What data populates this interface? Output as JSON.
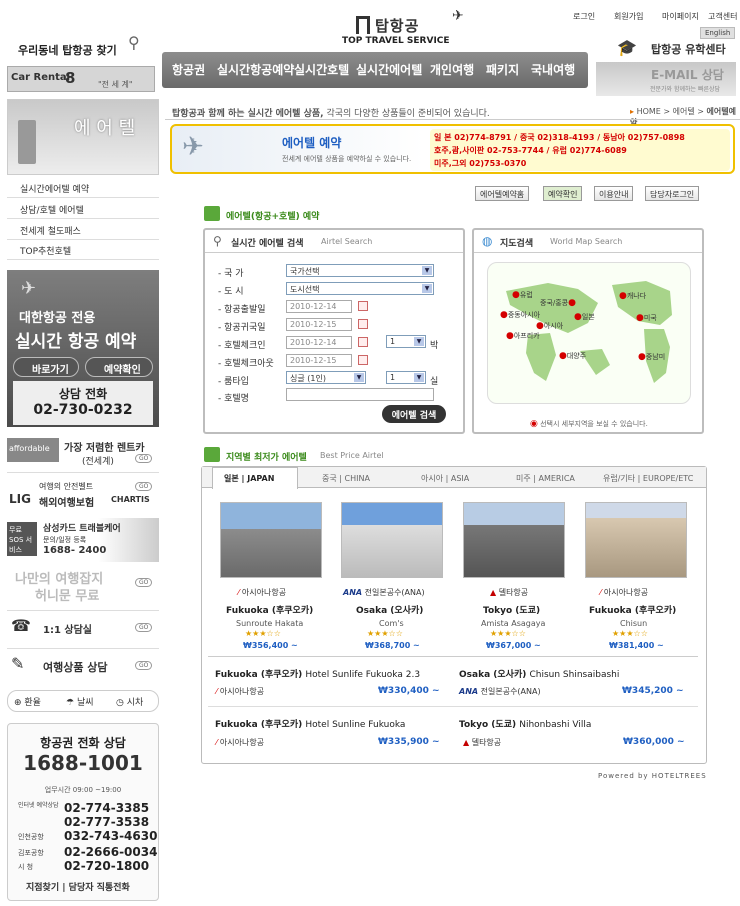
{
  "header": {
    "top_links": [
      "로그인",
      "회원가입",
      "마이페이지",
      "고객센터"
    ],
    "english": "English",
    "logo": "탑항공",
    "logo_sub": "TOP TRAVEL SERVICE",
    "local_find": "우리동네 탑항공 찾기",
    "nav": [
      "항공권",
      "실시간항공예약",
      "실시간호텔",
      "실시간에어텔",
      "개인여행",
      "패키지",
      "국내여행"
    ],
    "study_center": "탑항공 유학센타",
    "email_consult": "E-MAIL 상담",
    "email_sub": "전문가와 함께하는 빠른상담",
    "car_rental": "Car Rental",
    "car_rental_num": "8",
    "car_rental_world": "\"전 세 계\""
  },
  "sidebar": {
    "title": "에 어 텔",
    "menu": [
      "실시간에어텔 예약",
      "상담/호텔 에어텔",
      "전세계 철도패스",
      "TOP추천호텔"
    ],
    "promo": {
      "line1": "대한항공 전용",
      "line2": "실시간 항공 예약",
      "btn1": "바로가기",
      "btn2": "예약확인",
      "phone_label": "상담 전화",
      "phone": "02-730-0232"
    },
    "ads": [
      {
        "logo": "affordable",
        "title": "가장 저렴한 렌트카",
        "sub": "(전세계)"
      },
      {
        "logo": "LIG",
        "title": "여행의 안전벨트",
        "sub": "해외여행보험",
        "brand": "CHARTIS"
      },
      {
        "logo": "무료 SOS 서비스",
        "title": "삼성카드 트래블케어",
        "sub": "문의/일정 등록",
        "phone": "1688- 2400"
      },
      {
        "title": "나만의 여행잡지",
        "sub": "허니문 무료"
      }
    ],
    "consult": "1:1 상담실",
    "product_consult": "여행상품 상담",
    "go": "GO",
    "utils": [
      "환율",
      "날씨",
      "시차"
    ],
    "phone_box": {
      "title": "항공권 전화 상담",
      "number": "1688-1001",
      "hours": "업무시간  09:00 ~19:00",
      "lines": [
        {
          "label": "인터넷 예약상담",
          "value": "02-774-3385"
        },
        {
          "label": "",
          "value": "02-777-3538"
        },
        {
          "label": "인천공항",
          "value": "032-743-4630"
        },
        {
          "label": "김포공항",
          "value": "02-2666-0034"
        },
        {
          "label": "시   청",
          "value": "02-720-1800"
        }
      ],
      "footer": "지점찾기 | 담당자 직통전화"
    }
  },
  "main": {
    "intro_bold": "탑항공과 함께 하는 실시간 에어텔 상품,",
    "intro_rest": " 각국의 다양한 상품들이 준비되어 있습니다.",
    "breadcrumb": [
      "HOME",
      "에어텔",
      "에어텔예약"
    ],
    "banner_title": "에어텔 예약",
    "banner_sub": "전세계 에어텔 상품을 예약하실 수 있습니다.",
    "contacts": [
      "일   본 02)774-8791 / 중국 02)318-4193 / 동남아 02)757-0898",
      "호주,괌,사이판  02-753-7744 / 유럽 02)774-6089",
      "미주,그외 02)753-0370"
    ],
    "tabs": [
      "에어텔예약홈",
      "예약확인",
      "이용안내",
      "담당자로그인"
    ],
    "section_title": "에어텔(항공+호텔) 예약",
    "search": {
      "title": "실시간 에어텔 검색",
      "title_en": "Airtel Search",
      "fields": [
        {
          "label": "국    가",
          "value": "국가선택"
        },
        {
          "label": "도    시",
          "value": "도시선택"
        },
        {
          "label": "항공출발일",
          "value": "2010-12-14"
        },
        {
          "label": "항공귀국일",
          "value": "2010-12-15"
        },
        {
          "label": "호텔체크인",
          "value": "2010-12-14",
          "nights": "1",
          "unit": "박"
        },
        {
          "label": "호텔체크아웃",
          "value": "2010-12-15"
        },
        {
          "label": "룸타입",
          "value": "싱글 (1인)",
          "rooms": "1",
          "unit": "실"
        },
        {
          "label": "호텔명",
          "value": ""
        }
      ],
      "button": "에어텔 검색"
    },
    "map": {
      "title": "지도검색",
      "title_en": "World Map Search",
      "regions": [
        "유럽",
        "중국/홍콩",
        "캐나다",
        "중동아시아",
        "일본",
        "미국",
        "아시아",
        "아프리카",
        "대양주",
        "중남미"
      ],
      "note": "선택시 세부지역을 보실 수 있습니다."
    },
    "best": {
      "title": "지역별 최저가 에어텔",
      "title_en": "Best Price Airtel",
      "tabs": [
        "일본 | JAPAN",
        "중국 | CHINA",
        "아시아 | ASIA",
        "미주 | AMERICA",
        "유럽/기타 | EUROPE/ETC"
      ],
      "cards": [
        {
          "airline": "아시아나항공",
          "city": "Fukuoka (후쿠오카)",
          "hotel": "Sunroute Hakata",
          "stars": "★★★☆☆",
          "price": "₩356,400 ~"
        },
        {
          "airline": "전일본공수(ANA)",
          "city": "Osaka (오사카)",
          "hotel": "Com's",
          "stars": "★★★☆☆",
          "price": "₩368,700 ~"
        },
        {
          "airline": "델타항공",
          "city": "Tokyo (도쿄)",
          "hotel": "Amista Asagaya",
          "stars": "★★★☆☆",
          "price": "₩367,000 ~"
        },
        {
          "airline": "아시아나항공",
          "city": "Fukuoka (후쿠오카)",
          "hotel": "Chisun",
          "stars": "★★★☆☆",
          "price": "₩381,400 ~"
        }
      ],
      "rows": [
        {
          "city": "Fukuoka (후쿠오카)",
          "hotel": "Hotel Sunlife Fukuoka 2.3",
          "airline": "아시아나항공",
          "price": "₩330,400 ~"
        },
        {
          "city": "Osaka (오사카)",
          "hotel": "Chisun Shinsaibashi",
          "airline": "전일본공수(ANA)",
          "price": "₩345,200 ~"
        },
        {
          "city": "Fukuoka (후쿠오카)",
          "hotel": "Hotel Sunline Fukuoka",
          "airline": "아시아나항공",
          "price": "₩335,900 ~"
        },
        {
          "city": "Tokyo (도쿄)",
          "hotel": "Nihonbashi Villa",
          "airline": "델타항공",
          "price": "₩360,000 ~"
        }
      ]
    },
    "powered": "Powered by HOTELTREES"
  },
  "colors": {
    "accent_red": "#d40000",
    "price_blue": "#1f5fc2",
    "nav_gray": "#7a7a7a",
    "green_icon": "#5aa83a"
  }
}
